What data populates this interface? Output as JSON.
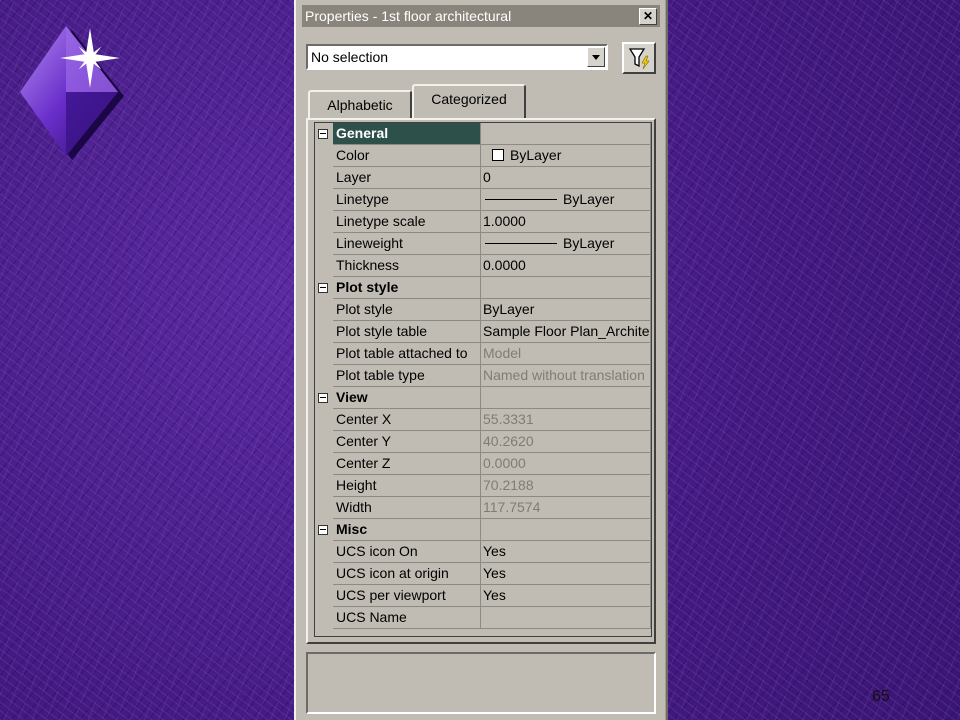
{
  "page_number": "65",
  "window": {
    "title": "Properties - 1st floor architectural",
    "close_label": "✕"
  },
  "selection": {
    "value": "No selection"
  },
  "tabs": [
    {
      "label": "Alphabetic",
      "active": false
    },
    {
      "label": "Categorized",
      "active": true
    }
  ],
  "categories": [
    {
      "name": "General",
      "rows": [
        {
          "name": "Color",
          "value": "ByLayer",
          "kind": "color"
        },
        {
          "name": "Layer",
          "value": "0"
        },
        {
          "name": "Linetype",
          "value": "ByLayer",
          "kind": "line"
        },
        {
          "name": "Linetype scale",
          "value": "1.0000"
        },
        {
          "name": "Lineweight",
          "value": "ByLayer",
          "kind": "line"
        },
        {
          "name": "Thickness",
          "value": "0.0000"
        }
      ]
    },
    {
      "name": "Plot style",
      "rows": [
        {
          "name": "Plot style",
          "value": "ByLayer"
        },
        {
          "name": "Plot style table",
          "value": "Sample Floor Plan_Archite"
        },
        {
          "name": "Plot table attached to",
          "value": "Model",
          "readonly": true
        },
        {
          "name": "Plot table type",
          "value": "Named without translation",
          "readonly": true
        }
      ]
    },
    {
      "name": "View",
      "rows": [
        {
          "name": "Center X",
          "value": "55.3331",
          "readonly": true
        },
        {
          "name": "Center Y",
          "value": "40.2620",
          "readonly": true
        },
        {
          "name": "Center Z",
          "value": "0.0000",
          "readonly": true
        },
        {
          "name": "Height",
          "value": "70.2188",
          "readonly": true
        },
        {
          "name": "Width",
          "value": "117.7574",
          "readonly": true
        }
      ]
    },
    {
      "name": "Misc",
      "rows": [
        {
          "name": "UCS icon On",
          "value": "Yes"
        },
        {
          "name": "UCS icon at origin",
          "value": "Yes"
        },
        {
          "name": "UCS per viewport",
          "value": "Yes"
        },
        {
          "name": "UCS Name",
          "value": ""
        }
      ]
    }
  ],
  "colors": {
    "background": "#4a1f8a",
    "dialog": "#c0bcb3",
    "titlebar": "#8a857c",
    "selected_category": "#2e504a"
  },
  "icons": {
    "logo": "purple-diamond-star-icon",
    "filter": "quick-select-filter-icon",
    "close": "close-icon"
  }
}
